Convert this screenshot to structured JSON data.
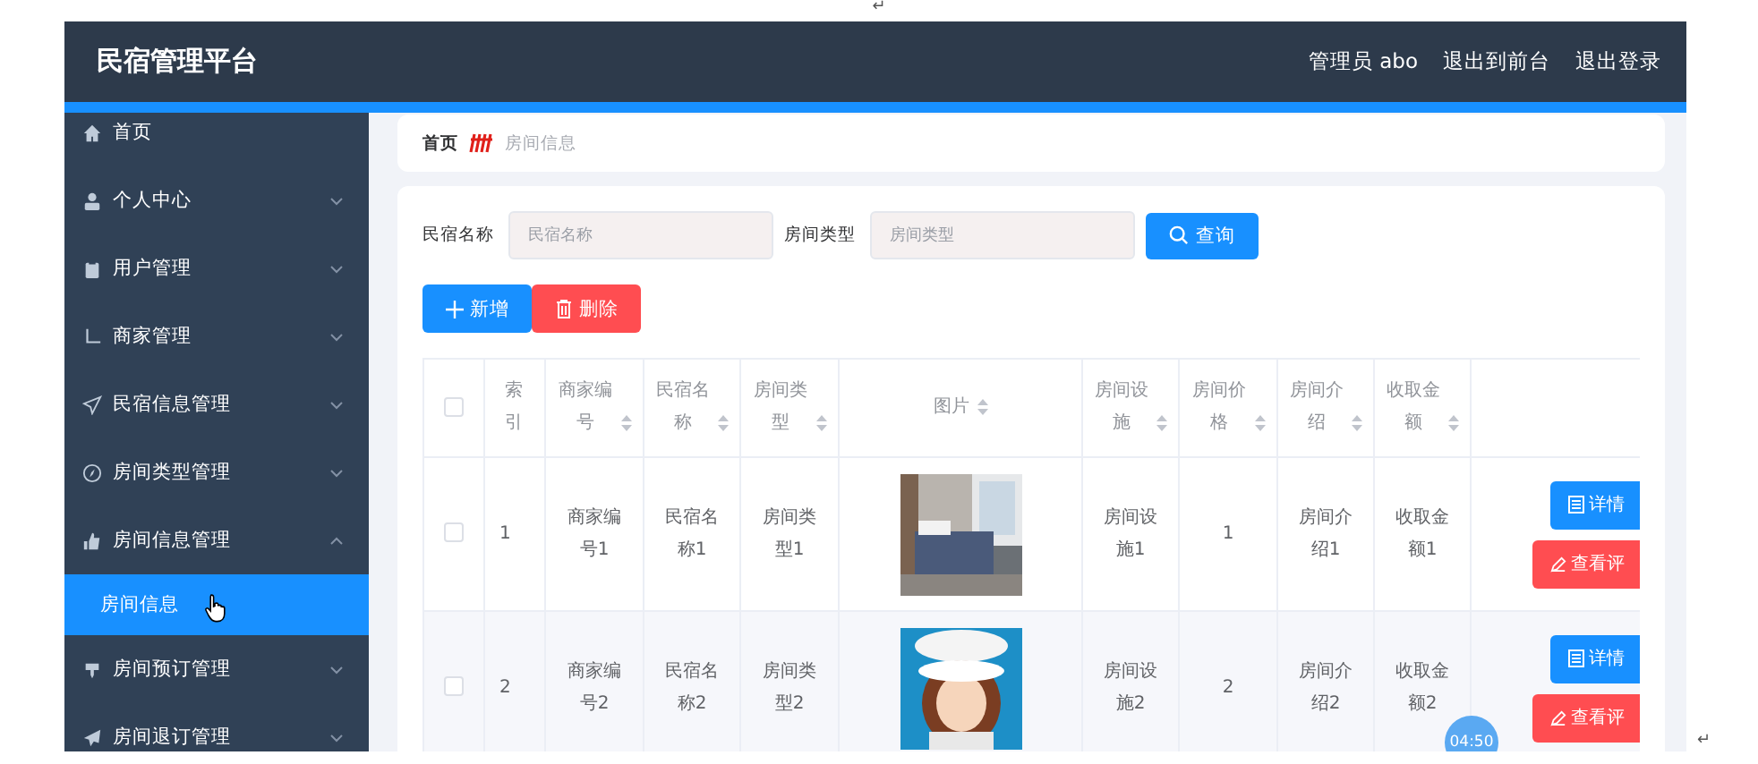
{
  "page_marks": [
    "↵",
    "↵"
  ],
  "header": {
    "title": "民宿管理平台",
    "links": [
      "管理员 abo",
      "退出到前台",
      "退出登录"
    ]
  },
  "sidebar": {
    "items": [
      {
        "label": "首页",
        "kind": "link"
      },
      {
        "label": "个人中心",
        "kind": "submenu",
        "expanded": false
      },
      {
        "label": "用户管理",
        "kind": "submenu",
        "expanded": false
      },
      {
        "label": "商家管理",
        "kind": "submenu",
        "expanded": false
      },
      {
        "label": "民宿信息管理",
        "kind": "submenu",
        "expanded": false
      },
      {
        "label": "房间类型管理",
        "kind": "submenu",
        "expanded": false
      },
      {
        "label": "房间信息管理",
        "kind": "submenu",
        "expanded": true,
        "children": [
          {
            "label": "房间信息",
            "selected": true
          }
        ]
      },
      {
        "label": "房间预订管理",
        "kind": "submenu",
        "expanded": false
      },
      {
        "label": "房间退订管理",
        "kind": "submenu",
        "expanded": false
      }
    ]
  },
  "breadcrumb": [
    "首页",
    "房间信息"
  ],
  "search": {
    "fields": [
      {
        "label": "民宿名称",
        "placeholder": "民宿名称"
      },
      {
        "label": "房间类型",
        "placeholder": "房间类型"
      }
    ],
    "button": "查询"
  },
  "actions": [
    {
      "label": "新增",
      "kind": "add"
    },
    {
      "label": "删除",
      "kind": "delete"
    }
  ],
  "table": {
    "all_checked": false,
    "columns": [
      {
        "label": "索引",
        "sortable": false
      },
      {
        "label": "商家编号",
        "sortable": true
      },
      {
        "label": "民宿名称",
        "sortable": true
      },
      {
        "label": "房间类型",
        "sortable": true
      },
      {
        "label": "图片",
        "sortable": true
      },
      {
        "label": "房间设施",
        "sortable": true
      },
      {
        "label": "房间价格",
        "sortable": true
      },
      {
        "label": "房间介绍",
        "sortable": true
      },
      {
        "label": "收取金额",
        "sortable": true
      }
    ],
    "rows": [
      {
        "checked": false,
        "cells": [
          "1",
          "商家编号1",
          "民宿名称1",
          "房间类型1",
          {
            "kind": "picture"
          },
          "房间设施1",
          "1",
          "房间介绍1",
          "收取金额1"
        ],
        "buttons": [
          {
            "label": "详情",
            "kind": "detail"
          },
          {
            "label": "查看评",
            "kind": "review"
          }
        ]
      },
      {
        "checked": false,
        "cells": [
          "2",
          "商家编号2",
          "民宿名称2",
          "房间类型2",
          {
            "kind": "picture"
          },
          "房间设施2",
          "2",
          "房间介绍2",
          "收取金额2"
        ],
        "buttons": [
          {
            "label": "详情",
            "kind": "detail"
          },
          {
            "label": "查看评",
            "kind": "review"
          }
        ]
      }
    ]
  },
  "timer_badge": "04:50"
}
